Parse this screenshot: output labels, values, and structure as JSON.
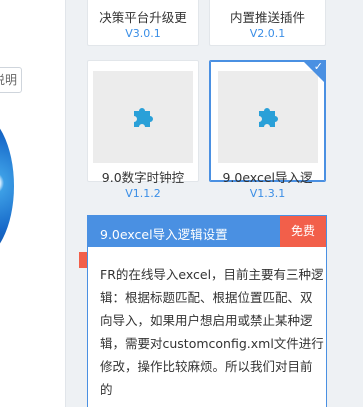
{
  "left": {
    "button_label": "说明"
  },
  "cards": [
    {
      "name": "决策平台升级更",
      "version": "V3.0.1"
    },
    {
      "name": "内置推送插件",
      "version": "V2.0.1"
    },
    {
      "name": "9.0数字时钟控",
      "version": "V1.1.2"
    },
    {
      "name": "9.0excel导入逻",
      "version": "V1.3.1",
      "selected": true
    }
  ],
  "popup": {
    "title": "9.0excel导入逻辑设置",
    "badge": "免费",
    "description": "FR的在线导入excel，目前主要有三种逻辑：根据标题匹配、根据位置匹配、双向导入，如果用户想启用或禁止某种逻辑，需要对customconfig.xml文件进行修改，操作比较麻烦。所以我们对目前的"
  },
  "colors": {
    "accent": "#4a90e2",
    "badge": "#f25f4a",
    "version": "#3a8ee6",
    "puzzle": "#2aa0d8"
  },
  "icons": {
    "plugin": "puzzle-icon",
    "selected": "check-icon"
  }
}
